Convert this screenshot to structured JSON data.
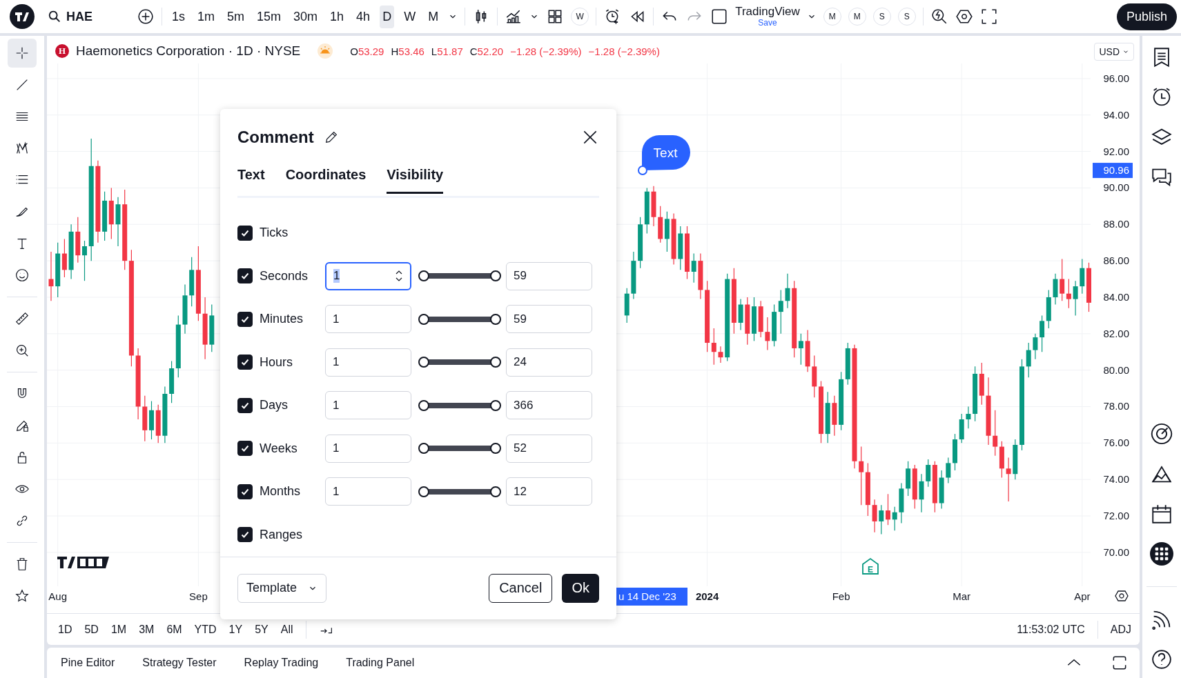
{
  "top_bar": {
    "symbol": "HAE",
    "timeframes": [
      {
        "label": "1s",
        "selected": false
      },
      {
        "label": "1m",
        "selected": false
      },
      {
        "label": "5m",
        "selected": false
      },
      {
        "label": "15m",
        "selected": false
      },
      {
        "label": "30m",
        "selected": false
      },
      {
        "label": "1h",
        "selected": false
      },
      {
        "label": "4h",
        "selected": false
      },
      {
        "label": "D",
        "selected": true
      },
      {
        "label": "W",
        "selected": false
      },
      {
        "label": "M",
        "selected": false
      }
    ],
    "indicator_badge": "W",
    "layout_name": "TradingView",
    "layout_status": "Save",
    "watchlist_badges": [
      "M",
      "M",
      "S",
      "S"
    ],
    "publish": "Publish"
  },
  "left_toolbar": [
    {
      "kind": "crosshair",
      "selected": true
    },
    {
      "kind": "line",
      "selected": false
    },
    {
      "kind": "lines",
      "selected": false
    },
    {
      "kind": "pattern",
      "selected": false
    },
    {
      "kind": "list",
      "selected": false
    },
    {
      "kind": "brush",
      "selected": false
    },
    {
      "kind": "text",
      "selected": false
    },
    {
      "kind": "smiley",
      "selected": false
    },
    {
      "kind": "ruler",
      "selected": false
    },
    {
      "kind": "zoom",
      "selected": false
    },
    {
      "kind": "magnet",
      "selected": false
    },
    {
      "kind": "pencil-lock",
      "selected": false
    },
    {
      "kind": "lock",
      "selected": false
    },
    {
      "kind": "eye",
      "selected": false
    },
    {
      "kind": "link",
      "selected": false
    },
    {
      "kind": "trash",
      "selected": false
    },
    {
      "kind": "star",
      "selected": false
    }
  ],
  "legend": {
    "badge": "H",
    "title": "Haemonetics Corporation · 1D · NYSE",
    "ohlc": [
      {
        "label": "O",
        "value": "53.29"
      },
      {
        "label": "H",
        "value": "53.46"
      },
      {
        "label": "L",
        "value": "51.87"
      },
      {
        "label": "C",
        "value": "52.20"
      }
    ],
    "change": "−1.28 (−2.39%)",
    "change_repeat": "−1.28 (−2.39%)"
  },
  "currency": "USD",
  "chart": {
    "chart_data": {
      "type": "candlestick",
      "yticks": [
        {
          "value": 96,
          "label": "96.00"
        },
        {
          "value": 94,
          "label": "94.00"
        },
        {
          "value": 92,
          "label": "92.00"
        },
        {
          "value": 90,
          "label": "90.00"
        },
        {
          "value": 88,
          "label": "88.00"
        },
        {
          "value": 86,
          "label": "86.00"
        },
        {
          "value": 84,
          "label": "84.00"
        },
        {
          "value": 82,
          "label": "82.00"
        },
        {
          "value": 80,
          "label": "80.00"
        },
        {
          "value": 78,
          "label": "78.00"
        },
        {
          "value": 76,
          "label": "76.00"
        },
        {
          "value": 74,
          "label": "74.00"
        },
        {
          "value": 72,
          "label": "72.00"
        },
        {
          "value": 70,
          "label": "70.00"
        }
      ],
      "ylim": [
        68.14,
        96.83
      ],
      "grid": true,
      "categories": [
        null,
        "Aug",
        null,
        null,
        null,
        null,
        null,
        null,
        null,
        null,
        null,
        null,
        null,
        null,
        null,
        null,
        null,
        null,
        null,
        null,
        null,
        null,
        "Sep",
        null,
        null,
        null,
        null,
        null,
        null,
        null,
        null,
        null,
        null,
        null,
        null,
        null,
        null,
        null,
        null,
        null,
        null,
        null,
        null,
        null,
        null,
        null,
        null,
        null,
        null,
        null,
        null,
        null,
        null,
        null,
        null,
        null,
        null,
        null,
        null,
        null,
        null,
        null,
        null,
        null,
        null,
        null,
        null,
        null,
        null,
        null,
        null,
        null,
        null,
        null,
        null,
        null,
        null,
        null,
        null,
        null,
        null,
        null,
        null,
        null,
        null,
        null,
        null,
        null,
        null,
        null,
        null,
        null,
        null,
        null,
        null,
        null,
        null,
        null,
        "2024",
        null,
        null,
        null,
        null,
        null,
        null,
        null,
        null,
        null,
        null,
        null,
        null,
        null,
        null,
        null,
        null,
        null,
        null,
        null,
        "Feb",
        null,
        null,
        null,
        null,
        null,
        null,
        null,
        null,
        null,
        null,
        null,
        null,
        null,
        null,
        null,
        null,
        null,
        "Mar",
        null,
        null,
        null,
        null,
        null,
        null,
        null,
        null,
        null,
        null,
        null,
        null,
        null,
        null,
        null,
        null,
        null,
        "Apr",
        null
      ],
      "ohlc": [
        [
          85.0,
          86.5,
          83.8,
          84.6
        ],
        [
          84.6,
          87.0,
          84.0,
          86.4
        ],
        [
          86.4,
          87.2,
          85.1,
          85.5
        ],
        [
          85.5,
          88.0,
          85.0,
          87.6
        ],
        [
          87.6,
          88.4,
          85.9,
          86.3
        ],
        [
          86.3,
          87.1,
          84.9,
          86.8
        ],
        [
          86.8,
          92.7,
          86.0,
          91.2
        ],
        [
          91.2,
          91.5,
          87.0,
          87.6
        ],
        [
          87.6,
          89.8,
          87.1,
          89.3
        ],
        [
          89.3,
          90.0,
          87.2,
          88.0
        ],
        [
          88.0,
          89.5,
          86.8,
          89.1
        ],
        [
          89.1,
          89.9,
          85.5,
          86.0
        ],
        [
          86.0,
          86.6,
          80.2,
          80.8
        ],
        [
          80.8,
          81.2,
          77.3,
          78.0
        ],
        [
          78.0,
          78.6,
          76.1,
          76.7
        ],
        [
          76.7,
          78.3,
          76.2,
          77.8
        ],
        [
          77.8,
          78.1,
          76.0,
          76.4
        ],
        [
          76.4,
          79.1,
          76.0,
          78.7
        ],
        [
          78.7,
          80.5,
          78.2,
          80.1
        ],
        [
          80.1,
          83.0,
          79.6,
          82.5
        ],
        [
          82.5,
          84.7,
          82.0,
          84.1
        ],
        [
          84.1,
          86.2,
          83.5,
          85.5
        ],
        [
          85.5,
          86.8,
          82.7,
          83.1
        ],
        [
          83.1,
          84.0,
          80.6,
          81.4
        ],
        [
          81.4,
          83.6,
          81.0,
          83.0
        ],
        null,
        null,
        null,
        null,
        null,
        null,
        null,
        null,
        null,
        null,
        null,
        null,
        null,
        null,
        null,
        null,
        null,
        null,
        null,
        null,
        null,
        null,
        null,
        null,
        null,
        null,
        null,
        null,
        null,
        null,
        null,
        null,
        null,
        null,
        null,
        null,
        null,
        null,
        null,
        null,
        null,
        null,
        null,
        null,
        null,
        null,
        null,
        null,
        null,
        null,
        null,
        null,
        null,
        null,
        null,
        null,
        null,
        null,
        null,
        null,
        null,
        [
          83.0,
          84.5,
          82.6,
          84.2
        ],
        [
          84.2,
          86.5,
          83.9,
          86.0
        ],
        [
          86.0,
          88.4,
          85.6,
          88.0
        ],
        [
          88.0,
          90.0,
          87.5,
          89.8
        ],
        [
          89.8,
          90.1,
          87.9,
          88.4
        ],
        [
          88.4,
          89.0,
          87.0,
          87.2
        ],
        [
          87.2,
          88.7,
          86.5,
          88.3
        ],
        [
          88.3,
          88.6,
          85.8,
          86.1
        ],
        [
          86.1,
          87.9,
          85.5,
          87.5
        ],
        [
          87.5,
          87.9,
          85.0,
          85.4
        ],
        [
          85.4,
          86.4,
          84.8,
          86.0
        ],
        [
          86.0,
          86.4,
          83.9,
          84.4
        ],
        [
          84.4,
          84.9,
          81.0,
          81.5
        ],
        [
          81.5,
          82.3,
          80.3,
          81.0
        ],
        [
          81.0,
          81.3,
          80.4,
          80.7
        ],
        [
          80.7,
          85.3,
          80.5,
          85.0
        ],
        [
          85.0,
          85.6,
          82.0,
          82.6
        ],
        [
          82.6,
          83.9,
          82.2,
          83.6
        ],
        [
          83.6,
          84.0,
          81.4,
          82.0
        ],
        [
          82.0,
          84.0,
          81.6,
          83.5
        ],
        [
          83.5,
          83.8,
          81.8,
          82.1
        ],
        [
          82.1,
          82.9,
          81.1,
          81.6
        ],
        [
          81.6,
          83.6,
          81.3,
          83.2
        ],
        [
          83.2,
          84.4,
          82.0,
          83.8
        ],
        [
          83.8,
          85.3,
          83.4,
          84.5
        ],
        [
          84.5,
          84.9,
          80.7,
          81.2
        ],
        [
          81.2,
          82.0,
          80.3,
          81.6
        ],
        [
          81.6,
          82.2,
          79.9,
          80.2
        ],
        [
          80.2,
          80.8,
          78.5,
          79.1
        ],
        [
          79.1,
          79.4,
          76.0,
          76.5
        ],
        [
          76.5,
          78.8,
          76.0,
          78.2
        ],
        [
          78.2,
          78.6,
          76.4,
          77.0
        ],
        [
          77.0,
          79.9,
          76.7,
          79.5
        ],
        [
          79.5,
          81.5,
          79.2,
          81.2
        ],
        [
          81.2,
          81.4,
          74.6,
          75.0
        ],
        [
          75.0,
          75.8,
          72.6,
          74.4
        ],
        [
          74.4,
          74.9,
          72.0,
          72.6
        ],
        [
          72.6,
          72.9,
          71.1,
          71.7
        ],
        [
          71.7,
          72.6,
          71.0,
          72.3
        ],
        [
          72.3,
          73.2,
          71.5,
          71.8
        ],
        [
          71.8,
          72.5,
          71.2,
          72.2
        ],
        [
          72.2,
          73.8,
          71.6,
          73.5
        ],
        [
          73.5,
          75.0,
          73.1,
          74.6
        ],
        [
          74.6,
          74.8,
          72.4,
          72.9
        ],
        [
          72.9,
          74.3,
          72.2,
          73.9
        ],
        [
          73.9,
          75.1,
          73.6,
          74.8
        ],
        [
          74.8,
          75.0,
          72.2,
          72.7
        ],
        [
          72.7,
          74.5,
          72.4,
          74.1
        ],
        [
          74.1,
          75.2,
          73.8,
          74.9
        ],
        [
          74.9,
          76.5,
          74.5,
          76.2
        ],
        [
          76.2,
          77.6,
          76.0,
          77.3
        ],
        [
          77.3,
          78.0,
          76.8,
          77.6
        ],
        [
          77.6,
          80.2,
          77.2,
          79.8
        ],
        [
          79.8,
          80.4,
          78.1,
          78.6
        ],
        [
          78.6,
          79.6,
          75.9,
          76.4
        ],
        [
          76.4,
          77.8,
          75.3,
          75.8
        ],
        [
          75.8,
          76.1,
          74.1,
          74.6
        ],
        [
          74.6,
          75.2,
          72.8,
          74.3
        ],
        [
          74.3,
          76.2,
          74.0,
          75.9
        ],
        [
          75.9,
          80.6,
          75.6,
          80.2
        ],
        [
          80.2,
          81.5,
          79.6,
          81.1
        ],
        [
          81.1,
          82.0,
          80.6,
          81.8
        ],
        [
          81.8,
          83.0,
          81.0,
          82.7
        ],
        [
          82.7,
          84.4,
          82.3,
          84.0
        ],
        [
          84.0,
          85.3,
          83.6,
          85.0
        ],
        [
          85.0,
          86.1,
          83.8,
          84.2
        ],
        [
          84.2,
          85.0,
          83.4,
          83.9
        ],
        [
          83.9,
          84.9,
          83.0,
          84.6
        ],
        [
          84.6,
          86.1,
          84.2,
          85.6
        ],
        [
          85.6,
          85.9,
          83.2,
          83.7
        ]
      ]
    },
    "time_axis_bold": [
      false,
      false,
      true,
      false,
      false,
      false
    ],
    "price_tag": "90.96",
    "crosshair_date": "u 14 Dec '23",
    "comment_bubble": "Text",
    "earnings_marker": "E"
  },
  "dialog": {
    "title": "Comment",
    "tabs": [
      {
        "label": "Text",
        "selected": false
      },
      {
        "label": "Coordinates",
        "selected": false
      },
      {
        "label": "Visibility",
        "selected": true
      }
    ],
    "rows": [
      {
        "kind": "checkbox",
        "label": "Ticks",
        "checked": true
      },
      {
        "kind": "range",
        "label": "Seconds",
        "checked": true,
        "from": "1",
        "to": "59",
        "level": 1,
        "focused": true
      },
      {
        "kind": "range",
        "label": "Minutes",
        "checked": true,
        "from": "1",
        "to": "59",
        "level": 1,
        "focused": false
      },
      {
        "kind": "range",
        "label": "Hours",
        "checked": true,
        "from": "1",
        "to": "24",
        "level": 1,
        "focused": false
      },
      {
        "kind": "range",
        "label": "Days",
        "checked": true,
        "from": "1",
        "to": "366",
        "level": 1,
        "focused": false
      },
      {
        "kind": "range",
        "label": "Weeks",
        "checked": true,
        "from": "1",
        "to": "52",
        "level": 1,
        "focused": false
      },
      {
        "kind": "range",
        "label": "Months",
        "checked": true,
        "from": "1",
        "to": "12",
        "level": 1,
        "focused": false
      },
      {
        "kind": "checkbox",
        "label": "Ranges",
        "checked": true
      }
    ],
    "template": "Template",
    "cancel": "Cancel",
    "ok": "Ok"
  },
  "range_bar": {
    "ranges": [
      "1D",
      "5D",
      "1M",
      "3M",
      "6M",
      "YTD",
      "1Y",
      "5Y",
      "All"
    ],
    "clock": "11:53:02 UTC",
    "adjust": "ADJ"
  },
  "bottom_tabs": [
    "Pine Editor",
    "Strategy Tester",
    "Replay Trading",
    "Trading Panel"
  ],
  "right_toolbar": [
    {
      "kind": "notes"
    },
    {
      "kind": "clock"
    },
    {
      "kind": "layers"
    },
    {
      "kind": "chat"
    },
    {
      "kind": "target"
    },
    {
      "kind": "mountain"
    },
    {
      "kind": "calendar"
    },
    {
      "kind": "apps"
    },
    {
      "kind": "signal"
    },
    {
      "kind": "help"
    }
  ]
}
